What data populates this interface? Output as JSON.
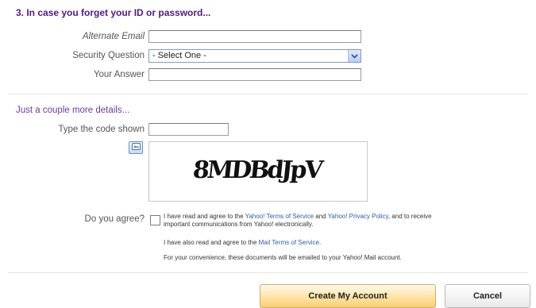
{
  "section3": {
    "title": "3. In case you forget your ID or password...",
    "alternate_email_label": "Alternate Email",
    "alternate_email_value": "",
    "security_question_label": "Security Question",
    "security_question_value": "- Select One -",
    "your_answer_label": "Your Answer",
    "your_answer_value": ""
  },
  "details": {
    "title": "Just a couple more details...",
    "code_label": "Type the code shown",
    "code_value": "",
    "captcha_text": "8MDBdJpV"
  },
  "agree": {
    "label": "Do you agree?",
    "line1_pre": "I have read and agree to the ",
    "tos_link": "Yahoo! Terms of Service",
    "line1_mid": " and ",
    "privacy_link": "Yahoo! Privacy Policy",
    "line1_post": ", and to receive",
    "line1b": "important communications from Yahoo! electronically.",
    "line2_pre": "I have also read and agree to the ",
    "mail_tos_link": "Mail Terms of Service",
    "line2_post": ".",
    "line3": "For your convenience, these documents will be emailed to your Yahoo! Mail account."
  },
  "buttons": {
    "create": "Create My Account",
    "cancel": "Cancel"
  },
  "colors": {
    "section_title": "#4e1a82",
    "link": "#2a5db0",
    "primary_button": "#fde3a3"
  },
  "icons": {
    "audio": "audio-captcha-icon",
    "select_arrow": "chevron-down-icon"
  }
}
